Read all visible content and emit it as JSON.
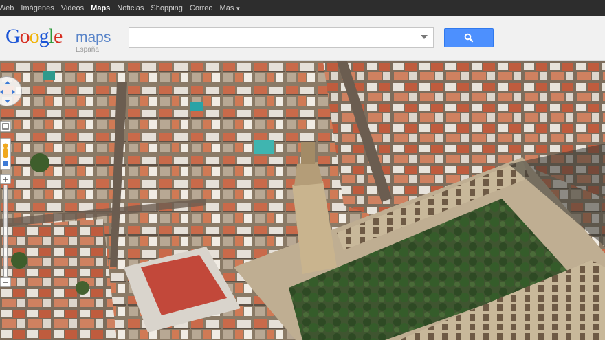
{
  "topbar": {
    "links": [
      "Web",
      "Imágenes",
      "Videos",
      "Maps",
      "Noticias",
      "Shopping",
      "Correo",
      "Más"
    ],
    "active": "Maps"
  },
  "header": {
    "logo_word": "Google",
    "product": "maps",
    "region": "España"
  },
  "search": {
    "value": "",
    "button_icon": "search-icon"
  },
  "colors": {
    "topbar_bg": "#2d2d2d",
    "header_bg": "#f1f1f1",
    "search_button": "#4d90fe"
  },
  "map": {
    "view": "aerial-45",
    "controls": [
      "pan-control",
      "rotate-control",
      "pegman-icon",
      "zoom-slider",
      "zoom-out-button"
    ]
  }
}
